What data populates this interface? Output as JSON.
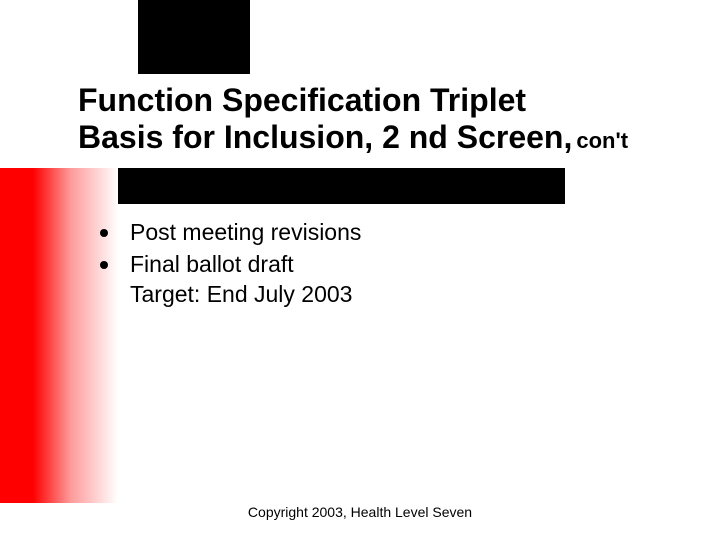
{
  "title": {
    "line1": "Function Specification Triplet",
    "line2": "Basis for Inclusion, 2 nd Screen,",
    "cont": "con't"
  },
  "bullets": [
    {
      "text": "Post meeting revisions"
    },
    {
      "text": "Final ballot draft\nTarget:  End July 2003"
    }
  ],
  "footer": "Copyright 2003, Health Level Seven"
}
